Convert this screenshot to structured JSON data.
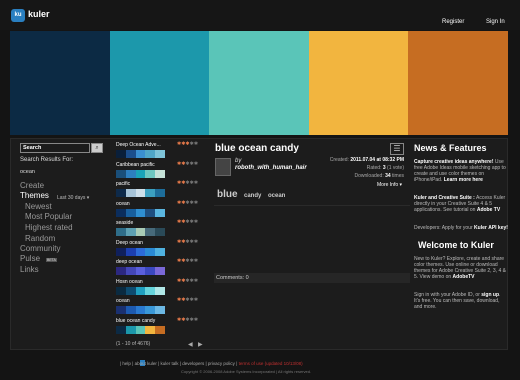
{
  "header": {
    "logo_badge": "ku",
    "logo_text": "kuler",
    "register": "Register",
    "sign_in": "Sign In"
  },
  "selected_theme_colors": [
    "#0c2a44",
    "#1c98ab",
    "#5ac5b8",
    "#f2b53f",
    "#c66d22"
  ],
  "sidebar": {
    "search_value": "Search",
    "search_button_icon": "binoculars-icon",
    "results_label": "Search Results For:",
    "results_query": "ocean",
    "nav": [
      {
        "label": "Create"
      },
      {
        "label": "Themes"
      },
      {
        "label": "Newest"
      },
      {
        "label": "Most Popular"
      },
      {
        "label": "Highest rated"
      },
      {
        "label": "Random"
      },
      {
        "label": "Community"
      },
      {
        "label": "Pulse"
      },
      {
        "label": "Links"
      }
    ],
    "themes_sort": "Last 30 days",
    "pulse_badge": "BETA"
  },
  "theme_list": {
    "items": [
      {
        "name": "Deep Ocean Adve...",
        "rating": 3,
        "colors": [
          "#0a1f3a",
          "#1b4e8c",
          "#3a8fd0",
          "#4fa6c8",
          "#7ec3d8"
        ]
      },
      {
        "name": "Caribbean pacific",
        "rating": 2,
        "colors": [
          "#1a4f7a",
          "#2d7fbf",
          "#1aa3b8",
          "#6ec7c0",
          "#c6e2d8"
        ]
      },
      {
        "name": "pacific",
        "rating": 2,
        "colors": [
          "#0e2a4a",
          "#a7c4d8",
          "#cfe0ea",
          "#3ca0c0",
          "#1d6d9a"
        ]
      },
      {
        "name": "ocean",
        "rating": 2,
        "colors": [
          "#0b2d5c",
          "#185f9e",
          "#2f8fd1",
          "#1e4f80",
          "#5ab6e0"
        ]
      },
      {
        "name": "seaside",
        "rating": 2,
        "colors": [
          "#2f6e8a",
          "#5ea1b3",
          "#a9cbb6",
          "#476a7a",
          "#2a4a58"
        ]
      },
      {
        "name": "Deep ocean",
        "rating": 2,
        "colors": [
          "#10205c",
          "#1c3fb0",
          "#2c6bd8",
          "#2a8ad4",
          "#4fb2e0"
        ]
      },
      {
        "name": "deep ocean",
        "rating": 2,
        "colors": [
          "#2c2880",
          "#4447b8",
          "#5a5fdc",
          "#3b48c0",
          "#7a68d8"
        ]
      },
      {
        "name": "Hosn ocean",
        "rating": 2,
        "colors": [
          "#0a2a40",
          "#0e4c70",
          "#20a0c0",
          "#66d4dc",
          "#b0e8e8"
        ]
      },
      {
        "name": "ocean",
        "rating": 2,
        "colors": [
          "#1a3070",
          "#1d5ab0",
          "#2a7ad0",
          "#3a98d8",
          "#6cb8e4"
        ]
      },
      {
        "name": "blue ocean candy",
        "rating": 2,
        "colors": [
          "#0c2a44",
          "#1c98ab",
          "#5ac5b8",
          "#f2b53f",
          "#c66d22"
        ]
      }
    ],
    "count": "(1 - 10 of 4676)",
    "prev": "◀",
    "next": "▶"
  },
  "detail": {
    "title": "blue ocean candy",
    "by": "by",
    "author": "roboth_with_human_hair",
    "created_label": "Created:",
    "created_value": "2011.07.04 at 08:32 PM",
    "rated_label": "Rated:",
    "rated_value": "3",
    "rated_votes": "(1 vote)",
    "downloaded_label": "Downloaded:",
    "downloaded_value": "34",
    "downloaded_suffix": "times",
    "more_info": "More Info",
    "tags": [
      "blue",
      "candy",
      "ocean"
    ],
    "comments_label": "Comments:",
    "comments_count": "0"
  },
  "news": {
    "header": "News & Features",
    "p1_bold": "Capture creative ideas anywhere!",
    "p1_text": "Use free Adobe Ideas mobile sketching app to create and use color themes on iPhone/iPad.",
    "p1_link": "Learn more here",
    "p2_bold": "Kuler and Creative Suite :",
    "p2_text": "Access Kuler directly in your Creative Suite 4 & 5 applications. See tutorial on",
    "p2_link": "Adobe TV",
    "p3_text": "Developers: Apply for your",
    "p3_bold1": "Kuler",
    "p3_bold2": "API key!",
    "welcome_header": "Welcome to Kuler",
    "p4_text": "New to Kuler? Explore, create and share color themes. Use online or download themes for Adobe Creative Suite 2, 3, 4 & 5. View demo on",
    "p4_link": "AdobeTV",
    "p5_text1": "Sign in with your Adobe ID, or",
    "p5_link": "sign up",
    "p5_text2": ". It's free. You can then save, download, and more."
  },
  "footer": {
    "links": [
      "help",
      "about kuler",
      "kuler talk",
      "developers",
      "privacy policy"
    ],
    "terms": "terms of use (updated 10/13/08)",
    "copyright": "Copyright © 2006-2008 Adobe Systems Incorporated  |  All rights reserved."
  }
}
